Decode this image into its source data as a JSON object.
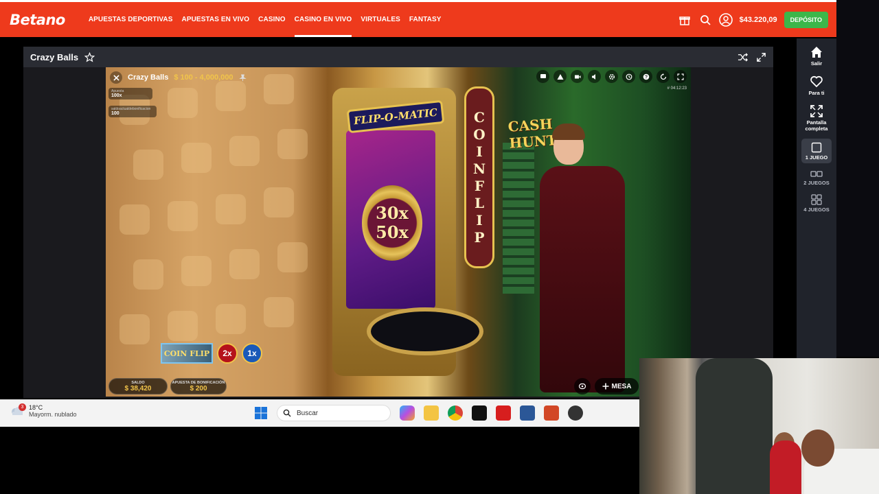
{
  "header": {
    "logo": "Betano",
    "nav": [
      "APUESTAS DEPORTIVAS",
      "APUESTAS EN VIVO",
      "CASINO",
      "CASINO EN VIVO",
      "VIRTUALES",
      "FANTASY"
    ],
    "active_nav": "CASINO EN VIVO",
    "balance": "$43.220,09",
    "deposit_label": "DEPÓSITO",
    "brand_color": "#ee3a1c",
    "deposit_color": "#3cb64a"
  },
  "sidebar": {
    "items": [
      {
        "label": "Salir",
        "icon": "home-icon"
      },
      {
        "label": "Para ti",
        "icon": "heart-icon"
      },
      {
        "label": "Pantalla completa",
        "icon": "fullscreen-icon"
      },
      {
        "label": "1 JUEGO",
        "icon": "single-window-icon"
      },
      {
        "label": "2 JUEGOS",
        "icon": "two-windows-icon"
      },
      {
        "label": "4 JUEGOS",
        "icon": "four-windows-icon"
      }
    ]
  },
  "frame": {
    "title": "Crazy Balls"
  },
  "game": {
    "title": "Crazy Balls",
    "range": "$ 100 - 4,000,000",
    "timestamp": "# 04:12:23",
    "info": [
      {
        "key": "Apuesta",
        "value": "100x"
      },
      {
        "key": "saldoactualdebonificacion",
        "value": "100"
      }
    ],
    "booth_sign": "FLIP-O-MATIC",
    "coin_values": [
      "30x",
      "50x"
    ],
    "coinflip_letters": [
      "C",
      "O",
      "I",
      "N",
      "F",
      "L",
      "I",
      "P"
    ],
    "cash_hunt": "CASH HUNT",
    "multipliers": {
      "coinflip": "COIN FLIP",
      "m1": "2x",
      "m2": "1x"
    },
    "saldo_label": "SALDO",
    "saldo_value": "$ 38,420",
    "bonus_label": "APUESTA DE BONIFICACIÓN",
    "bonus_value": "$ 200",
    "mesa_label": "MESA"
  },
  "taskbar": {
    "weather_temp": "18°C",
    "weather_desc": "Mayorm. nublado",
    "weather_badge": "3",
    "search_placeholder": "Buscar"
  }
}
